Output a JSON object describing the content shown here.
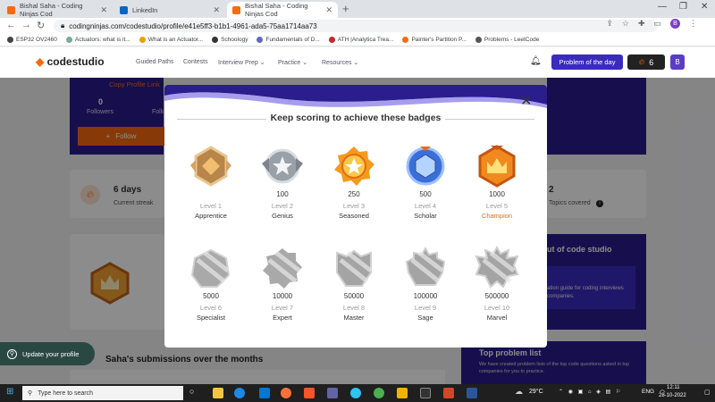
{
  "browser": {
    "tabs": [
      {
        "label": "Bishal Saha - Coding Ninjas Cod",
        "active": false
      },
      {
        "label": "LinkedIn",
        "active": false
      },
      {
        "label": "Bishal Saha - Coding Ninjas Cod",
        "active": true
      }
    ],
    "url": "codingninjas.com/codestudio/profile/e41e5ff3-b1b1-4961-ada5-75aa1714aa73",
    "bookmarks": [
      "ESP32 OV2460",
      "Actuators: what is it...",
      "What is an Actuator...",
      "Schoology",
      "Fundamentals of D...",
      "ATH |Analytica Trea...",
      "Painter's Partition P...",
      "Problems - LeetCode"
    ]
  },
  "header": {
    "logo": "codestudio",
    "nav": [
      "Guided Paths",
      "Contests",
      "Interview Prep",
      "Practice",
      "Resources"
    ],
    "problem_of_day": "Problem of the day",
    "streak_count": "6",
    "avatar_letter": "B"
  },
  "profile": {
    "copy_link": "Copy Profile Link",
    "followers_count": "0",
    "followers_label": "Followers",
    "following_label": "Follo",
    "follow_button": "Follow",
    "streak_days": "6 days",
    "streak_label": "Current streak",
    "topics_count": "2",
    "topics_label": "Topics covered",
    "submissions_heading": "Saha's submissions over the months",
    "about_heading": "ut of code studio",
    "guide_text": "ation guide for coding interviews",
    "guide_text2": "companies.",
    "top_problem_heading": "Top problem list",
    "top_problem_text": "We have created problem lists of the top code questions asked in top companies for you to practice.",
    "update_profile": "Update your profile"
  },
  "modal": {
    "title": "Keep scoring to achieve these badges",
    "badges": [
      {
        "score": "",
        "level": "Level 1",
        "name": "Apprentice",
        "tier": "bronze"
      },
      {
        "score": "100",
        "level": "Level 2",
        "name": "Genius",
        "tier": "silver"
      },
      {
        "score": "250",
        "level": "Level 3",
        "name": "Seasoned",
        "tier": "gold"
      },
      {
        "score": "500",
        "level": "Level 4",
        "name": "Scholar",
        "tier": "blue"
      },
      {
        "score": "1000",
        "level": "Level 5",
        "name": "Champion",
        "tier": "crown"
      },
      {
        "score": "5000",
        "level": "Level 6",
        "name": "Specialist",
        "tier": "locked"
      },
      {
        "score": "10000",
        "level": "Level 7",
        "name": "Expert",
        "tier": "locked"
      },
      {
        "score": "50000",
        "level": "Level 8",
        "name": "Master",
        "tier": "locked"
      },
      {
        "score": "100000",
        "level": "Level 9",
        "name": "Sage",
        "tier": "locked"
      },
      {
        "score": "500000",
        "level": "Level 10",
        "name": "Marvel",
        "tier": "locked"
      }
    ]
  },
  "taskbar": {
    "search_placeholder": "Type here to search",
    "temperature": "29°C",
    "language": "ENG",
    "time": "12:11",
    "date": "28-10-2022"
  },
  "colors": {
    "accent": "#f66b0e",
    "brand": "#3a2bbf",
    "dark_purple": "#2a1d8c"
  }
}
